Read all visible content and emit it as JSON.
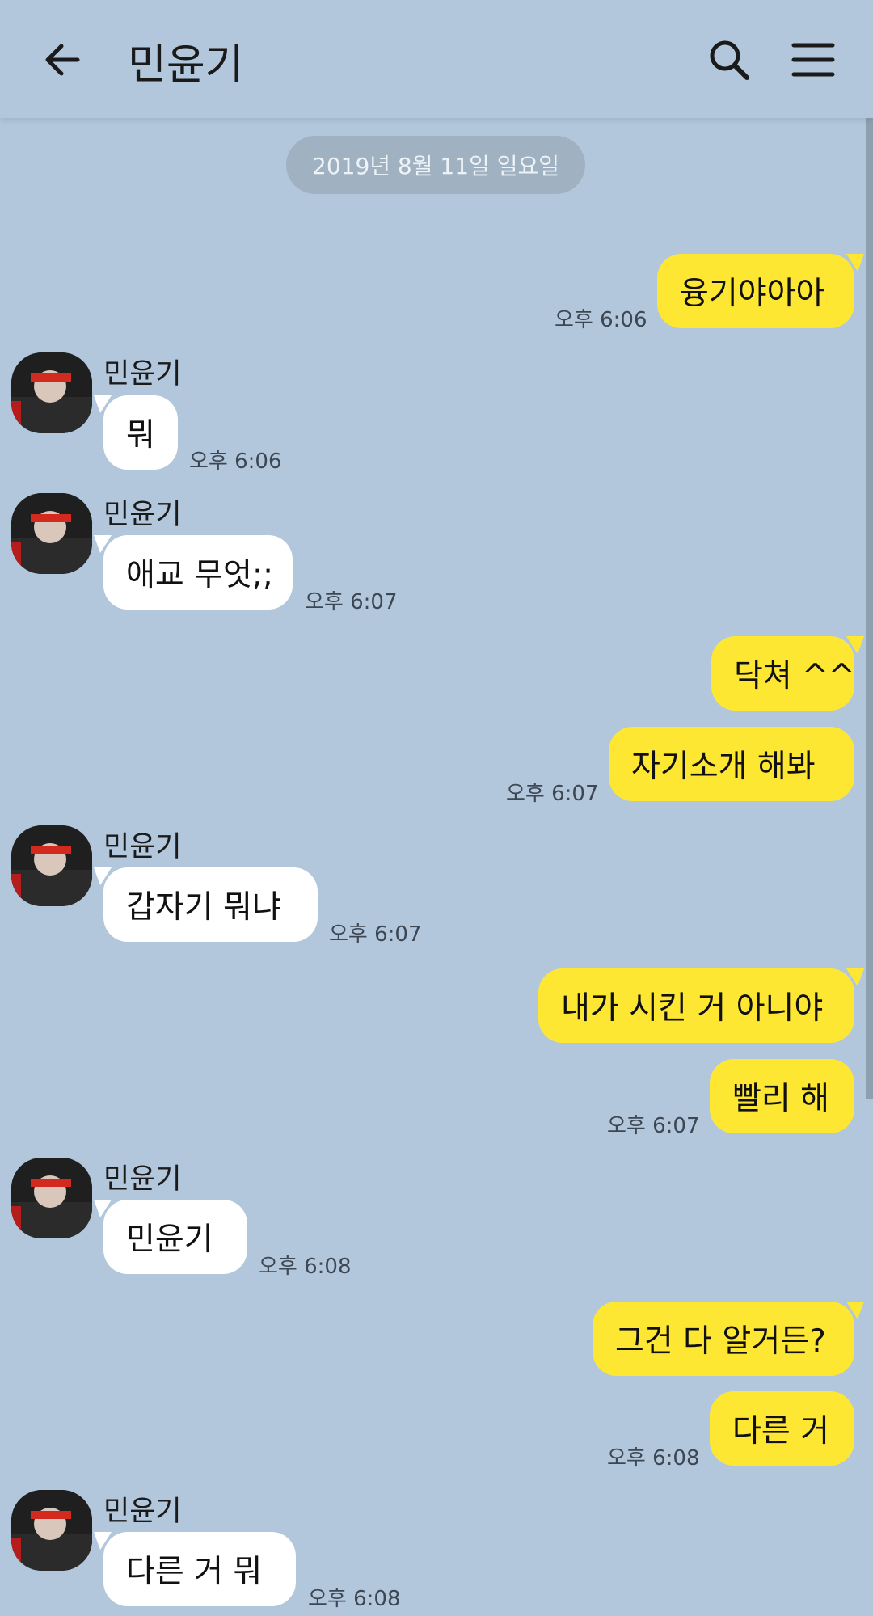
{
  "header": {
    "title": "민윤기",
    "icons": {
      "back": "arrow-left-icon",
      "search": "search-icon",
      "menu": "hamburger-menu-icon"
    }
  },
  "date_divider": "2019년 8월 11일 일요일",
  "colors": {
    "background": "#b2c7dc",
    "my_bubble": "#fee733",
    "their_bubble": "#ffffff"
  },
  "messages": [
    {
      "from": "me",
      "text": "융기야아아",
      "time": "오후 6:06"
    },
    {
      "from": "them",
      "sender": "민윤기",
      "text": "뭐",
      "time": "오후 6:06"
    },
    {
      "from": "them",
      "sender": "민윤기",
      "text": "애교 무엇;;",
      "time": "오후 6:07"
    },
    {
      "from": "me",
      "text": "닥쳐 ^^",
      "time": ""
    },
    {
      "from": "me",
      "text": "자기소개 해봐",
      "time": "오후 6:07"
    },
    {
      "from": "them",
      "sender": "민윤기",
      "text": "갑자기 뭐냐",
      "time": "오후 6:07"
    },
    {
      "from": "me",
      "text": "내가 시킨 거 아니야",
      "time": ""
    },
    {
      "from": "me",
      "text": "빨리 해",
      "time": "오후 6:07"
    },
    {
      "from": "them",
      "sender": "민윤기",
      "text": "민윤기",
      "time": "오후 6:08"
    },
    {
      "from": "me",
      "text": "그건 다 알거든?",
      "time": ""
    },
    {
      "from": "me",
      "text": "다른 거",
      "time": "오후 6:08"
    },
    {
      "from": "them",
      "sender": "민윤기",
      "text": "다른 거 뭐",
      "time": "오후 6:08"
    }
  ]
}
